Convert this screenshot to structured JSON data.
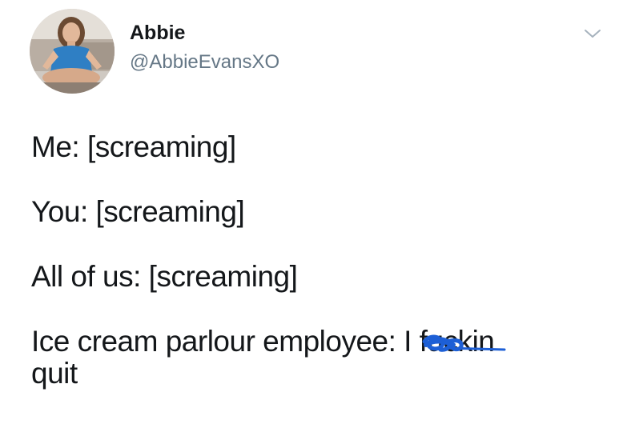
{
  "author": {
    "display_name": "Abbie",
    "handle": "@AbbieEvansXO"
  },
  "tweet": {
    "lines": [
      "Me: [screaming]",
      "You: [screaming]",
      "All of us: [screaming]"
    ],
    "last_line": {
      "prefix": "Ice cream parlour employee: I f",
      "censored_word": "uckin",
      "suffix": "quit"
    }
  },
  "icons": {
    "menu": "chevron-down-icon",
    "scribble": "blue-scribble-censor"
  },
  "colors": {
    "text": "#14171a",
    "handle": "#657786",
    "scribble": "#1d5fd6"
  }
}
